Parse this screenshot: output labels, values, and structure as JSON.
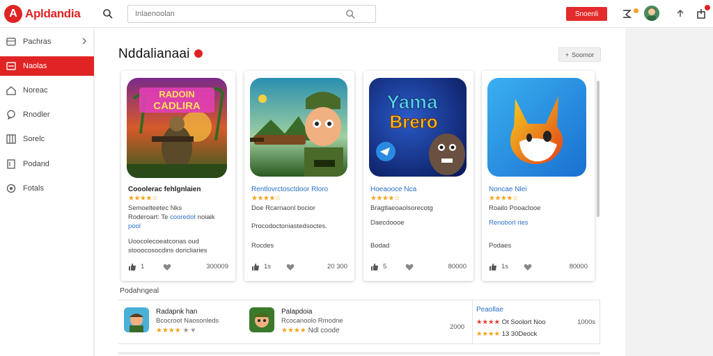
{
  "brand": {
    "logo_letter": "A",
    "name": "Apldandia",
    "accent": "#e02424"
  },
  "header": {
    "search_placeholder": "Inlaenoolan",
    "signin_label": "Snoenli"
  },
  "sidebar": {
    "items": [
      {
        "label": "Pachras",
        "icon": "grid-icon"
      },
      {
        "label": "Naolas",
        "icon": "list-icon"
      },
      {
        "label": "Noreac",
        "icon": "home-icon"
      },
      {
        "label": "Rnodler",
        "icon": "chat-icon"
      },
      {
        "label": "Sorelc",
        "icon": "book-icon"
      },
      {
        "label": "Podand",
        "icon": "bookmark-icon"
      },
      {
        "label": "Fotals",
        "icon": "settings-icon"
      }
    ]
  },
  "main": {
    "title": "Nddalianaai",
    "filter_label": "Soornor",
    "cards": [
      {
        "title": "Cooolerac fehlgnlaien",
        "stars": "★★★★☆",
        "line1": "Semoelteetec Nks",
        "line2": "Roderoart: Te",
        "line2_blue": "cooredot",
        "line2_tail": "noiaik",
        "line3_blue": "pool",
        "desc1": "Uoocolecoeatconas oud",
        "desc2": "stooocosocdins doricliaries",
        "likes": "1",
        "number": "300009"
      },
      {
        "title": "Rentlovrctosctdoor Rloro",
        "stars": "★★★★☆",
        "line1": "Doe Rcarnaonl bocior",
        "line2": "Procodoctoniastedsoctes.",
        "line3": "Rocdes",
        "likes": "1s",
        "number": "20 300"
      },
      {
        "title": "Hoeaooce Nca",
        "stars": "★★★★☆",
        "line1": "Bragtlaeoaolsorecotg",
        "line2": "Daecdoooe",
        "line3": "Bodad",
        "likes": "5",
        "number": "80000"
      },
      {
        "title": "Noncae Nlei",
        "stars": "★★★★☆",
        "line1": "Roailo Pooaclooe",
        "line2": "Renoborl ries",
        "line3": "Podaes",
        "likes": "1s",
        "number": "80000"
      }
    ],
    "section_label": "Podahngeal",
    "list": [
      {
        "title": "Radapnk han",
        "sub": "Bcocroot Naosonleds",
        "stars": "★★★★",
        "extra": "★ ♥"
      },
      {
        "title": "Palapdoia",
        "sub": "Rcocanoolo Rmodne",
        "stars": "★★★★",
        "extra": "Ndl coode"
      }
    ],
    "list_value": "2000",
    "right_panel": {
      "title": "Peaollae",
      "row1_text": "Ot Soolort Noo",
      "row1_stars": "★★★★",
      "row1_value": "1000s",
      "row2_text": "13 30Deock",
      "row2_stars": "★★★★"
    }
  }
}
